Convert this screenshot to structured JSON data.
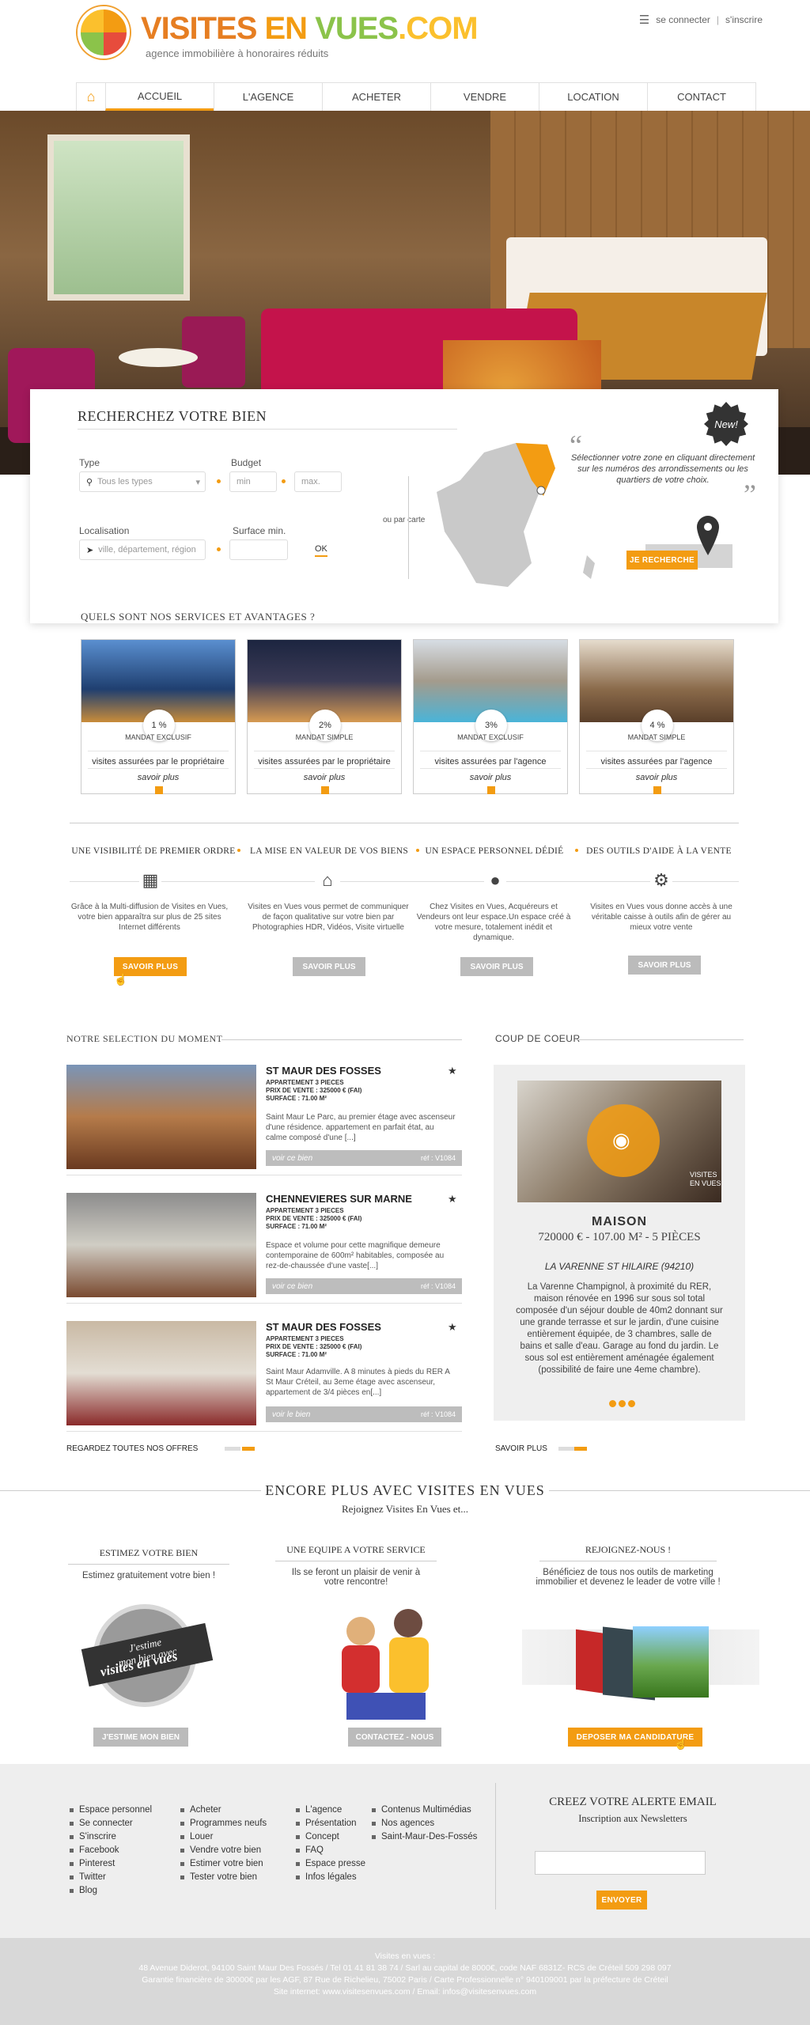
{
  "header": {
    "logo_main": "VISITES EN VUES.COM",
    "logo_part1": "VISITES ",
    "logo_part2": "EN ",
    "logo_part3": "VUES",
    "logo_part4": ".COM",
    "tagline": "agence immobilière à honoraires réduits",
    "login": "se connecter",
    "separator": "|",
    "signup": "s'inscrire"
  },
  "nav": {
    "items": [
      "ACCUEIL",
      "L'AGENCE",
      "ACHETER",
      "VENDRE",
      "LOCATION",
      "CONTACT"
    ],
    "active": "ACCUEIL"
  },
  "search": {
    "title": "RECHERCHEZ VOTRE BIEN",
    "new_badge": "New!",
    "type_label": "Type",
    "type_placeholder": "Tous les types",
    "budget_label": "Budget",
    "budget_min": "min",
    "budget_max": "max.",
    "loc_label": "Localisation",
    "loc_placeholder": "ville, département, région",
    "surface_label": "Surface min.",
    "ok": "OK",
    "or_map": "ou par carte",
    "map_text": "Sélectionner votre zone en cliquant directement sur les numéros des arrondissements ou les quartiers de votre choix.",
    "search_button": "JE RECHERCHE"
  },
  "services": {
    "title": "QUELS SONT NOS SERVICES ET AVANTAGES ?",
    "cards": [
      {
        "pct": "1 %",
        "type": "MANDAT EXCLUSIF",
        "text": "visites assurées par le propriétaire",
        "more": "savoir plus"
      },
      {
        "pct": "2%",
        "type": "MANDAT SIMPLE",
        "text": "visites assurées par le propriétaire",
        "more": "savoir plus"
      },
      {
        "pct": "3%",
        "type": "MANDAT EXCLUSIF",
        "text": "visites assurées par l'agence",
        "more": "savoir plus"
      },
      {
        "pct": "4 %",
        "type": "MANDAT SIMPLE",
        "text": "visites assurées par l'agence",
        "more": "savoir plus"
      }
    ]
  },
  "features": [
    {
      "title": "UNE VISIBILITÉ DE PREMIER ORDRE",
      "text": "Grâce à la Multi-diffusion de Visites en Vues, votre bien apparaîtra sur plus de 25 sites Internet différents",
      "button": "SAVOIR PLUS"
    },
    {
      "title": "LA MISE EN VALEUR DE VOS BIENS",
      "text": "Visites en Vues vous permet de communiquer de façon qualitative sur votre bien par Photographies HDR, Vidéos, Visite virtuelle",
      "button": "SAVOIR PLUS"
    },
    {
      "title": "UN ESPACE PERSONNEL DÉDIÉ",
      "text": "Chez Visites en Vues, Acquéreurs et Vendeurs ont leur espace.Un espace créé à votre mesure, totalement inédit et dynamique.",
      "button": "SAVOIR PLUS"
    },
    {
      "title": "DES OUTILS D'AIDE À LA VENTE",
      "text": "Visites en Vues vous donne accès à une véritable caisse à outils afin de gérer au mieux votre vente",
      "button": "SAVOIR PLUS"
    }
  ],
  "selection": {
    "title": "NOTRE SELECTION DU MOMENT",
    "see_all": "REGARDEZ TOUTES NOS OFFRES",
    "items": [
      {
        "name": "ST MAUR DES FOSSES",
        "rooms": "APPARTEMENT 3 PIECES",
        "price": "PRIX DE VENTE : 325000 € (FAI)",
        "surface": "SURFACE : 71.00 M²",
        "desc": "Saint Maur Le Parc, au premier étage avec ascenseur d'une résidence. appartement en parfait état, au calme composé d'une [...]",
        "link": "voir ce bien",
        "ref": "réf : V1084"
      },
      {
        "name": "CHENNEVIERES SUR MARNE",
        "rooms": "APPARTEMENT 3 PIECES",
        "price": "PRIX DE VENTE : 325000 € (FAI)",
        "surface": "SURFACE : 71.00 M²",
        "desc": "Espace et volume pour cette magnifique demeure contemporaine de 600m² habitables, composée au rez-de-chaussée d'une vaste[...]",
        "link": "voir ce bien",
        "ref": "réf : V1084"
      },
      {
        "name": "ST MAUR DES FOSSES",
        "rooms": "APPARTEMENT 3 PIECES",
        "price": "PRIX DE VENTE : 325000 € (FAI)",
        "surface": "SURFACE : 71.00 M²",
        "desc": "Saint Maur Adamville. A 8 minutes à pieds du RER A St Maur Créteil, au 3eme étage avec ascenseur, appartement de 3/4 pièces en[...]",
        "link": "voir le bien",
        "ref": "réf : V1084"
      }
    ]
  },
  "coeur": {
    "title": "COUP DE COEUR",
    "type": "MAISON",
    "price": "720000 € - 107.00 M² - 5 PIÈCES",
    "city": "LA VARENNE ST HILAIRE (94210)",
    "desc": "La Varenne Champignol, à proximité du RER, maison rénovée en 1996 sur sous sol total composée d'un séjour double de 40m2 donnant sur une grande terrasse et sur le jardin, d'une cuisine entièrement équipée, de 3 chambres, salle de bains et salle d'eau. Garage au fond du jardin. Le sous sol est entièrement aménagée également (possibilité de faire une 4eme chambre).",
    "more": "SAVOIR PLUS",
    "watermark": "VISITES EN VUES"
  },
  "encore": {
    "title": "ENCORE PLUS AVEC VISITES EN VUES",
    "subtitle": "Rejoignez Visites En Vues  et...",
    "cols": [
      {
        "title": "ESTIMEZ VOTRE BIEN",
        "text": "Estimez gratuitement votre bien !",
        "button": "J'ESTIME MON BIEN",
        "badge1": "J'estime",
        "badge2": "mon bien avec",
        "badge3": "visites en vues"
      },
      {
        "title": "UNE EQUIPE A VOTRE SERVICE",
        "text": "Ils se feront un plaisir de venir à votre rencontre!",
        "button": "CONTACTEZ - NOUS"
      },
      {
        "title": "REJOIGNEZ-NOUS !",
        "text": "Bénéficiez de tous nos outils de marketing immobilier et devenez le leader de votre ville !",
        "button": "DEPOSER MA CANDIDATURE"
      }
    ]
  },
  "footer": {
    "col1": [
      "Espace personnel",
      "Se connecter",
      "S'inscrire",
      "Facebook",
      "Pinterest",
      "Twitter",
      "Blog"
    ],
    "col2": [
      "Acheter",
      "Programmes neufs",
      "Louer",
      "Vendre votre bien",
      "Estimer votre bien",
      "Tester votre bien"
    ],
    "col3": [
      "L'agence",
      "Présentation",
      "Concept",
      "FAQ",
      "Espace presse",
      "Infos légales"
    ],
    "col4": [
      "Contenus Multimédias",
      "Nos agences",
      "Saint-Maur-Des-Fossés"
    ],
    "alert_title": "CREEZ VOTRE ALERTE EMAIL",
    "alert_sub": "Inscription aux Newsletters",
    "send": "ENVOYER"
  },
  "legal": [
    "Visites en vues :",
    "48 Avenue Diderot, 94100 Saint Maur Des Fossés / Tel 01 41 81 38 74 / Sarl au capital de 8000€, code NAF 6831Z- RCS de Créteil 509 298 097",
    "Garantie financière de 30000€ par les AGF, 87 Rue de Richelieu, 75002 Paris / Carte Professionnelle n° 940109001 par la préfecture de Créteil",
    "Site internet: www.visitesenvues.com / Email: infos@visitesenvues.com"
  ],
  "colors": {
    "accent": "#f39c12",
    "gray_button": "#bbbbbb"
  }
}
